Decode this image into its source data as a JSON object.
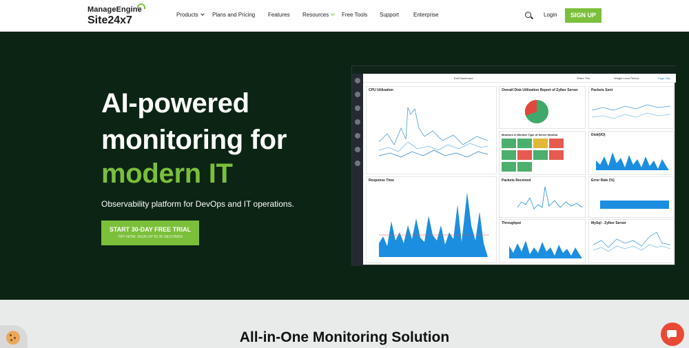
{
  "brand": {
    "top": "ManageEngine",
    "bottom": "Site24x7",
    "accent": "#7bbf3a"
  },
  "nav": {
    "items": [
      "Products",
      "Plans and Pricing",
      "Features",
      "Resources",
      "Free Tools",
      "Support",
      "Enterprise"
    ],
    "login": "Login",
    "signup": "SIGN UP"
  },
  "hero": {
    "line1": "AI-powered",
    "line2": "monitoring for",
    "line3": "modern IT",
    "subtitle": "Observability platform for DevOps and IT operations.",
    "cta_main": "START 30-DAY FREE TRIAL",
    "cta_sub": "TRY NOW, SIGN UP IN 30 SECONDS",
    "bg": "#0c2414"
  },
  "dashboard": {
    "toolbar": {
      "edit": "Edit Dashboard",
      "share": "Share This",
      "period": "Widget Level Period",
      "page_tips": "Page Tips"
    },
    "widgets": {
      "cpu": "CPU Utilization",
      "disk_report": "Overall Disk Utilization Report of Zylker Server",
      "packets_sent": "Packets Sent",
      "monitors": "Monitors in Monitor Type of Server Monitor",
      "disk_io": "Disk(I/O)",
      "response": "Response Time",
      "packets_received": "Packets Received",
      "error_rate": "Error Rate (%)",
      "throughput": "Throughput",
      "mysql": "MySql - Zylker Server"
    },
    "monitor_status_colors": [
      "#4caf6d",
      "#4caf6d",
      "#e0b83a",
      "#e65a50",
      "#4caf6d",
      "#e65a50",
      "#4caf6d",
      "#e65a50",
      "#4caf6d",
      "#4caf6d"
    ]
  },
  "section": {
    "title": "All-in-One Monitoring Solution"
  },
  "icons": {
    "search": "search-icon",
    "cookie": "cookie-icon",
    "chat": "chat-icon"
  }
}
